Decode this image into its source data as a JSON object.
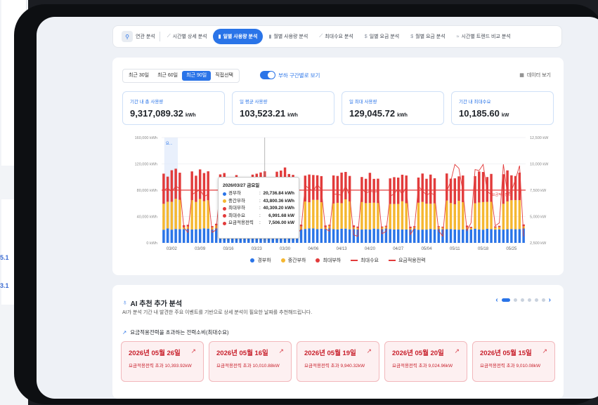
{
  "background": {
    "fragments": [
      "5.1",
      "3.1"
    ]
  },
  "tabs": [
    {
      "label": "연관 분석",
      "icon": "rocket-icon",
      "active": false
    },
    {
      "label": "시간별 상세 분석",
      "icon": "trend-icon",
      "active": false
    },
    {
      "label": "일별 사용량 분석",
      "icon": "bar-icon",
      "active": true
    },
    {
      "label": "월별 사용량 분석",
      "icon": "bar-icon",
      "active": false
    },
    {
      "label": "최대수요 분석",
      "icon": "trend-icon",
      "active": false
    },
    {
      "label": "일별 요금 분석",
      "icon": "dollar-icon",
      "active": false
    },
    {
      "label": "월별 요금 분석",
      "icon": "dollar-icon",
      "active": false
    },
    {
      "label": "시간별 트렌드 비교 분석",
      "icon": "compare-icon",
      "active": false
    }
  ],
  "range": {
    "options": [
      "최근 30일",
      "최근 60일",
      "최근 90일",
      "직접선택"
    ],
    "selected": "최근 90일"
  },
  "toggle": {
    "label": "부하 구간별로 보기",
    "on": true
  },
  "data_view_label": "데이터 보기",
  "stats": [
    {
      "label": "기간 내 총 사용량",
      "value": "9,317,089.32",
      "unit": "kWh"
    },
    {
      "label": "일 평균 사용량",
      "value": "103,523.21",
      "unit": "kWh"
    },
    {
      "label": "일 최대 사용량",
      "value": "129,045.72",
      "unit": "kWh"
    },
    {
      "label": "기간 내 최대수요",
      "value": "10,185.60",
      "unit": "kW"
    }
  ],
  "tooltip": {
    "date": "2026/03/27 금요일",
    "rows": [
      {
        "name": "경부하",
        "value": "20,736.84 kWh",
        "color": "#2a74e8"
      },
      {
        "name": "중간부하",
        "value": "43,800.36 kWh",
        "color": "#f5b731"
      },
      {
        "name": "최대부하",
        "value": "40,309.20 kWh",
        "color": "#e23b3b"
      },
      {
        "name": "최대수요",
        "value": "6,991.68 kW",
        "color": "#e23b3b"
      },
      {
        "name": "요금적용전력",
        "value": "7,506.00 kW",
        "color": "#e23b3b"
      }
    ]
  },
  "chart_data": {
    "type": "bar",
    "x_ticks": [
      "03/02",
      "03/09",
      "03/16",
      "03/23",
      "03/30",
      "04/06",
      "04/13",
      "04/20",
      "04/27",
      "05/04",
      "05/11",
      "05/18",
      "05/25"
    ],
    "y_left_ticks": [
      "0 kWh",
      "40,000 kWh",
      "80,000 kWh",
      "120,000 kWh",
      "160,000 kWh"
    ],
    "y_right_ticks": [
      "2,500 kW",
      "5,000 kW",
      "7,500 kW",
      "10,000 kW",
      "12,500 kW"
    ],
    "ylim_left": [
      0,
      160000
    ],
    "ylim_right": [
      2500,
      12500
    ],
    "num_days": 90,
    "stacked": true,
    "annotation_marker_label": "요...",
    "reference_line_label": "요금적용전력",
    "series": [
      {
        "name": "경부하",
        "type": "bar",
        "color": "#2a74e8",
        "low": 20000,
        "high": 22000
      },
      {
        "name": "중간부하",
        "type": "bar",
        "color": "#f5b731",
        "low": 38000,
        "high": 46000
      },
      {
        "name": "최대부하",
        "type": "bar",
        "color": "#e23b3b",
        "low": 36000,
        "high": 48000
      },
      {
        "name": "최대수요",
        "type": "line",
        "color": "#e23b3b",
        "low": 6900,
        "high": 10185.6
      },
      {
        "name": "요금적용전력",
        "type": "line",
        "color": "#e23b3b",
        "value": 7506
      }
    ]
  },
  "legend": [
    {
      "name": "경부하",
      "kind": "dot",
      "color": "#2a74e8"
    },
    {
      "name": "중간부하",
      "kind": "dot",
      "color": "#f5b731"
    },
    {
      "name": "최대부하",
      "kind": "dot",
      "color": "#e23b3b"
    },
    {
      "name": "최대수요",
      "kind": "line",
      "color": "#e23b3b"
    },
    {
      "name": "요금적용전력",
      "kind": "line",
      "color": "#e23b3b"
    }
  ],
  "ai": {
    "title": "AI 추천 추가 분석",
    "subtitle": "AI가 분석 기간 내 발견한 주요 이벤트를 기반으로 상세 분석이 필요한 날짜를 추천해드립니다.",
    "section": "요금적용전력을 초과하는 전력소비(최대수요)",
    "pages": 6,
    "current_page": 0,
    "cards": [
      {
        "date": "2026년 05월 26일",
        "text": "요금적용전력 초과 10,393.92kW"
      },
      {
        "date": "2026년 05월 16일",
        "text": "요금적용전력 초과 10,010.88kW"
      },
      {
        "date": "2026년 05월 19일",
        "text": "요금적용전력 초과 9,940.32kW"
      },
      {
        "date": "2026년 05월 20일",
        "text": "요금적용전력 초과 9,024.96kW"
      },
      {
        "date": "2026년 05월 15일",
        "text": "요금적용전력 초과 9,010.08kW"
      }
    ]
  }
}
